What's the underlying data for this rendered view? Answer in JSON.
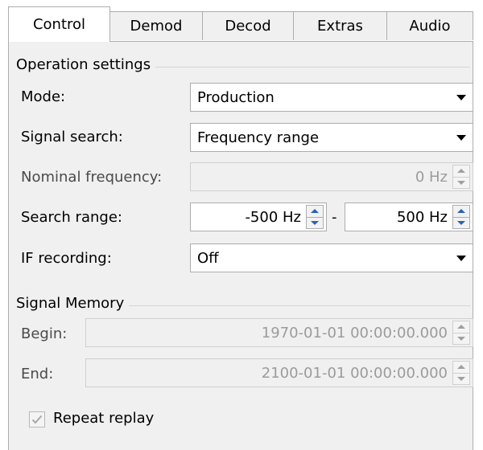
{
  "tabs": [
    {
      "label": "Control",
      "active": true
    },
    {
      "label": "Demod",
      "active": false
    },
    {
      "label": "Decod",
      "active": false
    },
    {
      "label": "Extras",
      "active": false
    },
    {
      "label": "Audio",
      "active": false
    }
  ],
  "operation_settings": {
    "title": "Operation settings",
    "mode": {
      "label": "Mode:",
      "value": "Production"
    },
    "signal_search": {
      "label": "Signal search:",
      "value": "Frequency range"
    },
    "nominal_frequency": {
      "label": "Nominal frequency:",
      "value": "0 Hz",
      "enabled": false
    },
    "search_range": {
      "label": "Search range:",
      "from": "-500 Hz",
      "separator": "-",
      "to": "500 Hz"
    },
    "if_recording": {
      "label": "IF recording:",
      "value": "Off"
    }
  },
  "signal_memory": {
    "title": "Signal Memory",
    "begin": {
      "label": "Begin:",
      "value": "1970-01-01 00:00:00.000",
      "enabled": false
    },
    "end": {
      "label": "End:",
      "value": "2100-01-01 00:00:00.000",
      "enabled": false
    },
    "repeat_replay": {
      "label": "Repeat replay",
      "checked": true,
      "enabled": false
    }
  }
}
